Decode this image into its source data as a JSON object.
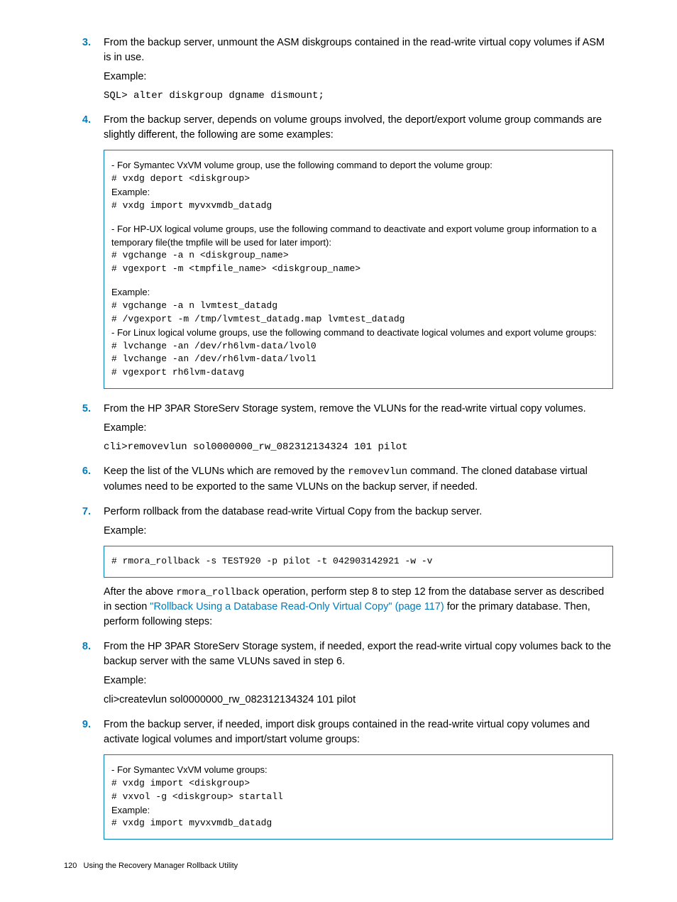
{
  "steps": {
    "s3": {
      "num": "3.",
      "text": "From the backup server, unmount the ASM diskgroups contained in the read-write virtual copy volumes if ASM is in use.",
      "example_label": "Example:",
      "cmd": "SQL> alter diskgroup dgname dismount;"
    },
    "s4": {
      "num": "4.",
      "text": "From the backup server, depends on volume groups involved, the deport/export volume group commands are slightly different, the following are some examples:",
      "box": {
        "l1": "- For Symantec VxVM volume group, use the following command to deport the volume group:",
        "l2": "# vxdg deport  <diskgroup>",
        "l3": "Example:",
        "l4": "# vxdg import myvxvmdb_datadg",
        "l5": "-  For HP-UX logical volume groups, use the following command to deactivate and export volume group information to a temporary file(the tmpfile will be used for later import):",
        "l6": "# vgchange -a n <diskgroup_name>",
        "l7": " # vgexport -m <tmpfile_name> <diskgroup_name>",
        "l8": "Example:",
        "l9": "# vgchange -a n lvmtest_datadg",
        "l10": "# /vgexport -m /tmp/lvmtest_datadg.map lvmtest_datadg",
        "l11": "- For Linux logical volume groups,  use the following command to deactivate logical volumes and export volume groups:",
        "l12": "# lvchange -an /dev/rh6lvm-data/lvol0",
        "l13": "# lvchange -an /dev/rh6lvm-data/lvol1",
        "l14": "# vgexport rh6lvm-datavg"
      }
    },
    "s5": {
      "num": "5.",
      "text": "From the HP 3PAR StoreServ Storage system, remove the VLUNs for the read-write virtual copy volumes.",
      "example_label": "Example:",
      "cmd": "cli>removevlun sol0000000_rw_082312134324 101 pilot"
    },
    "s6": {
      "num": "6.",
      "text_a": "Keep the list of the VLUNs which are removed by the ",
      "text_cmd": "removevlun",
      "text_b": " command. The cloned database virtual volumes need to be exported to the same VLUNs on the backup server, if needed."
    },
    "s7": {
      "num": "7.",
      "text": "Perform rollback from the database read-write Virtual Copy from the backup server.",
      "example_label": "Example:",
      "box_cmd": "# rmora_rollback -s TEST920 -p pilot -t 042903142921 -w -v",
      "after_a": "After the above ",
      "after_cmd": "rmora_rollback",
      "after_b": " operation, perform step 8 to step 12 from the database server as described in section ",
      "link": "\"Rollback Using a Database Read-Only Virtual Copy\" (page 117)",
      "after_c": " for the primary database. Then, perform following steps:"
    },
    "s8": {
      "num": "8.",
      "text": "From the HP 3PAR StoreServ Storage system, if needed, export the read-write virtual copy volumes back to the backup server with the same VLUNs saved in step 6.",
      "example_label": "Example:",
      "cmd": "cli>createvlun sol0000000_rw_082312134324 101 pilot"
    },
    "s9": {
      "num": "9.",
      "text": "From the backup server, if needed, import disk groups contained in the read-write virtual copy volumes and activate logical volumes and import/start volume groups:",
      "box": {
        "l1": "- For Symantec VxVM volume groups:",
        "l2": "# vxdg import <diskgroup>",
        "l3": "# vxvol -g <diskgroup> startall",
        "l4": "Example:",
        "l5": "# vxdg import myvxvmdb_datadg"
      }
    }
  },
  "footer": {
    "page": "120",
    "title": "Using the Recovery Manager Rollback Utility"
  }
}
